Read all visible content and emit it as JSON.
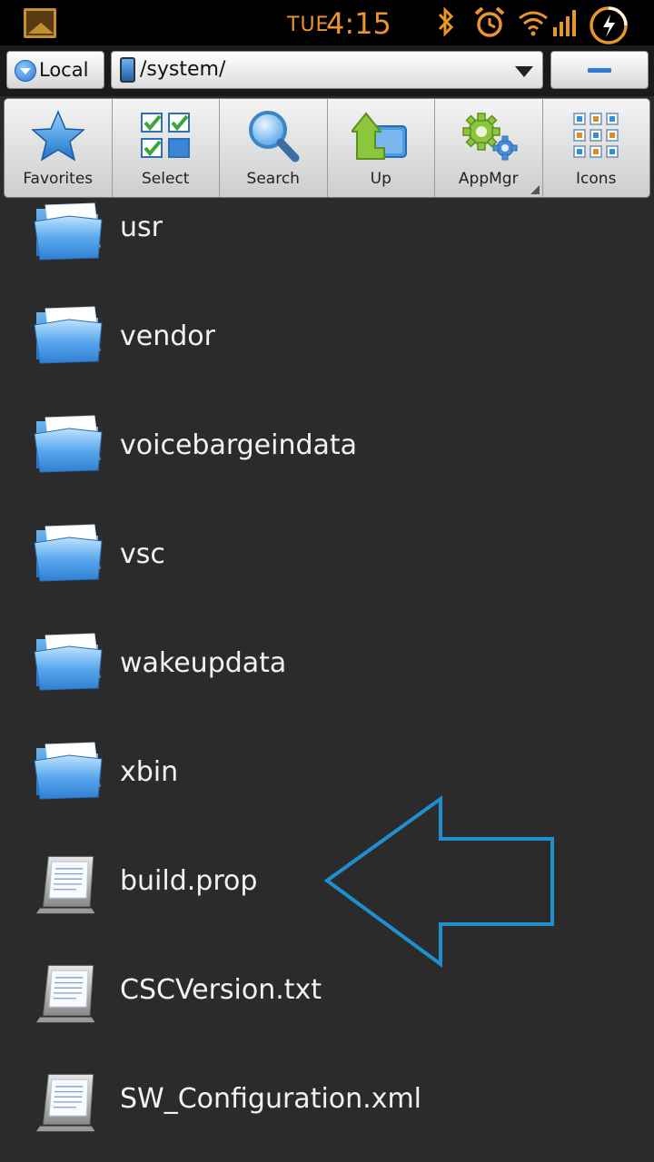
{
  "status_bar": {
    "day": "TUE",
    "time": "4:15",
    "icons": [
      "gallery-icon",
      "bluetooth-icon",
      "alarm-icon",
      "wifi-icon",
      "signal-icon",
      "battery-charging-icon"
    ],
    "accent_color": "#e8952e"
  },
  "pathbar": {
    "local_label": "Local",
    "path": "/system/"
  },
  "toolbar": {
    "items": [
      {
        "label": "Favorites",
        "icon": "star-icon"
      },
      {
        "label": "Select",
        "icon": "checklist-icon"
      },
      {
        "label": "Search",
        "icon": "magnifier-icon"
      },
      {
        "label": "Up",
        "icon": "up-folder-icon"
      },
      {
        "label": "AppMgr",
        "icon": "gears-icon"
      },
      {
        "label": "Icons",
        "icon": "icon-grid-icon"
      }
    ]
  },
  "files": [
    {
      "name": "usr",
      "type": "folder"
    },
    {
      "name": "vendor",
      "type": "folder"
    },
    {
      "name": "voicebargeindata",
      "type": "folder"
    },
    {
      "name": "vsc",
      "type": "folder"
    },
    {
      "name": "wakeupdata",
      "type": "folder"
    },
    {
      "name": "xbin",
      "type": "folder"
    },
    {
      "name": "build.prop",
      "type": "file"
    },
    {
      "name": "CSCVersion.txt",
      "type": "file"
    },
    {
      "name": "SW_Configuration.xml",
      "type": "file"
    }
  ],
  "annotation": {
    "icon": "left-arrow-outline",
    "color": "#1f8fd0"
  }
}
